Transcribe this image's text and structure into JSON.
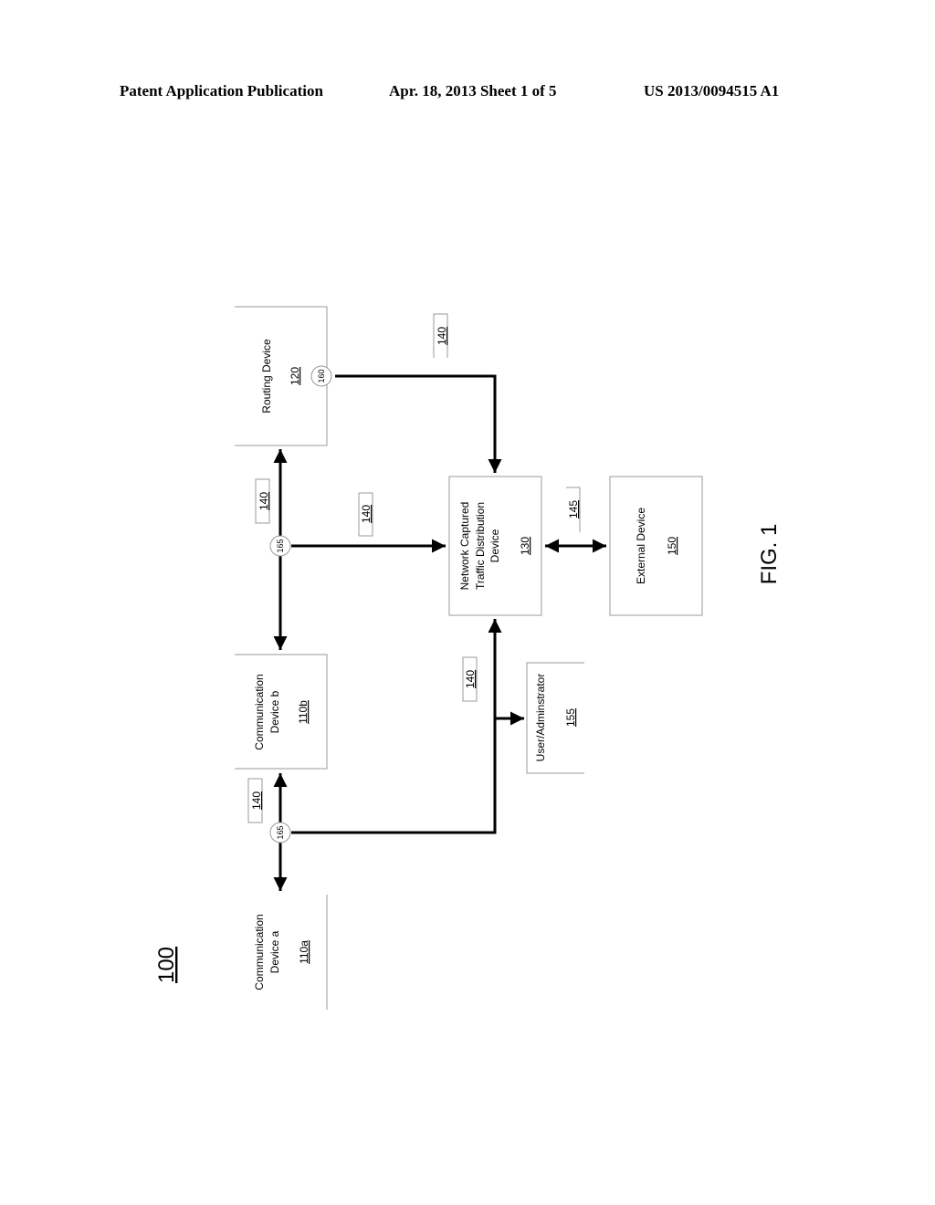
{
  "header": {
    "publication": "Patent Application Publication",
    "date_sheet": "Apr. 18, 2013  Sheet 1 of 5",
    "pub_number": "US 2013/0094515 A1"
  },
  "figure": {
    "system_ref": "100",
    "caption": "FIG. 1",
    "blocks": {
      "comm_a": {
        "line1": "Communication",
        "line2": "Device a",
        "ref": "110a"
      },
      "comm_b": {
        "line1": "Communication",
        "line2": "Device b",
        "ref": "110b"
      },
      "routing": {
        "line1": "Routing Device",
        "ref": "120"
      },
      "nctd": {
        "line1": "Network Captured",
        "line2": "Traffic Distribution",
        "line3": "Device",
        "ref": "130"
      },
      "external": {
        "line1": "External  Device",
        "ref": "150"
      },
      "user": {
        "line1": "User/Adminstrator",
        "ref": "155"
      }
    },
    "link_refs": {
      "link_top": "140",
      "link_routing_b": "140",
      "link_tap_nctd": "140",
      "link_a_b": "140",
      "link_user": "140",
      "link_external": "145"
    },
    "nodes": {
      "port_routing": "160",
      "tap_upper": "165",
      "tap_lower": "165"
    }
  }
}
